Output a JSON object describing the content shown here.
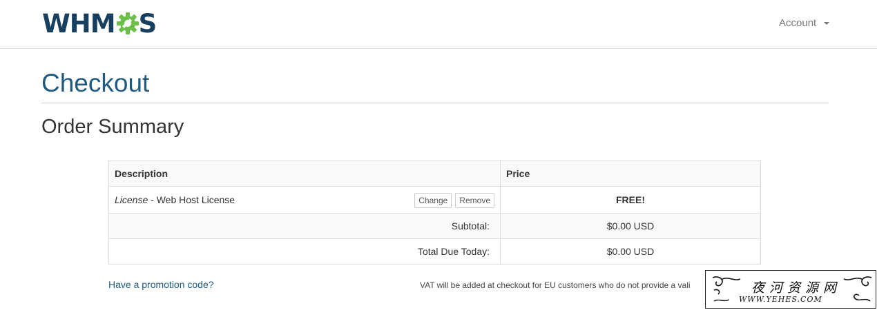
{
  "brand": {
    "logo_text_left": "WHM",
    "logo_text_right": "S"
  },
  "nav": {
    "account_label": "Account"
  },
  "page": {
    "title": "Checkout",
    "section_title": "Order Summary"
  },
  "summary_table": {
    "headers": {
      "description": "Description",
      "price": "Price"
    },
    "item": {
      "name": "License",
      "separator": " - ",
      "detail": "Web Host License",
      "change_label": "Change",
      "remove_label": "Remove",
      "price": "FREE!"
    },
    "subtotal": {
      "label": "Subtotal:",
      "value": "$0.00 USD"
    },
    "total": {
      "label": "Total Due Today:",
      "value": "$0.00 USD"
    }
  },
  "footer": {
    "promo_link": "Have a promotion code?",
    "vat_note": "VAT will be added at checkout for EU customers who do not provide a vali"
  },
  "watermark": {
    "chinese": "夜河资源网",
    "url": "WWW.YEHES.COM"
  },
  "colors": {
    "brand_navy": "#173f5f",
    "brand_green": "#6cc04a",
    "title_blue": "#1f5a80",
    "row_stripe": "#f9f9f9"
  },
  "icons": {
    "account_menu": "caret-down-icon",
    "logo": "gear-icon"
  }
}
